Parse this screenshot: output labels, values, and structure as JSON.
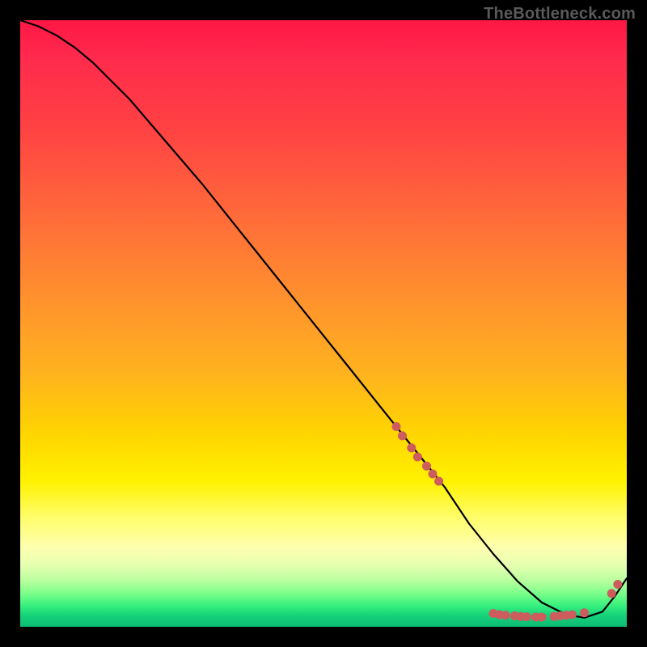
{
  "watermark": "TheBottleneck.com",
  "colors": {
    "background": "#000000",
    "curve": "#000000",
    "marker": "#cd5c5c",
    "watermark_text": "#5a5a5a"
  },
  "chart_data": {
    "type": "line",
    "title": "",
    "xlabel": "",
    "ylabel": "",
    "xlim": [
      0,
      100
    ],
    "ylim": [
      0,
      100
    ],
    "grid": false,
    "legend": false,
    "series": [
      {
        "name": "bottleneck-curve",
        "x": [
          0,
          3,
          6,
          9,
          12,
          18,
          24,
          30,
          36,
          42,
          48,
          54,
          60,
          66,
          70,
          74,
          78,
          82,
          86,
          90,
          93,
          96,
          98,
          100
        ],
        "y": [
          100,
          99,
          97.5,
          95.5,
          93,
          87,
          80,
          73,
          65.5,
          58,
          50.5,
          43,
          35.5,
          28,
          23,
          17,
          12,
          7.5,
          4,
          2,
          1.5,
          2.5,
          5,
          8
        ]
      }
    ],
    "markers": [
      {
        "x": 62,
        "y": 33
      },
      {
        "x": 63,
        "y": 31.5
      },
      {
        "x": 64.5,
        "y": 29.5
      },
      {
        "x": 65.5,
        "y": 28
      },
      {
        "x": 67,
        "y": 26.5
      },
      {
        "x": 68,
        "y": 25.2
      },
      {
        "x": 69,
        "y": 24
      },
      {
        "x": 78,
        "y": 2.2
      },
      {
        "x": 79,
        "y": 2.0
      },
      {
        "x": 80,
        "y": 1.9
      },
      {
        "x": 81.5,
        "y": 1.8
      },
      {
        "x": 82.5,
        "y": 1.7
      },
      {
        "x": 83.5,
        "y": 1.65
      },
      {
        "x": 85,
        "y": 1.6
      },
      {
        "x": 86,
        "y": 1.6
      },
      {
        "x": 88,
        "y": 1.7
      },
      {
        "x": 89,
        "y": 1.8
      },
      {
        "x": 90,
        "y": 1.9
      },
      {
        "x": 91,
        "y": 2.0
      },
      {
        "x": 93,
        "y": 2.3
      },
      {
        "x": 97.5,
        "y": 5.5
      },
      {
        "x": 98.5,
        "y": 7.0
      }
    ]
  }
}
